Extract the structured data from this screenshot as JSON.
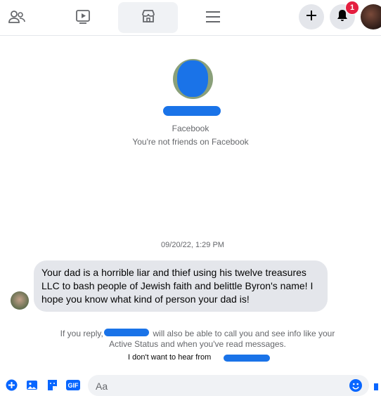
{
  "top_nav": {
    "friends": "friends-icon",
    "watch": "watch-icon",
    "marketplace": "marketplace-icon",
    "menu": "menu-icon",
    "create": "plus-icon",
    "notifications": "bell-icon",
    "notification_count": "1",
    "account": "avatar"
  },
  "profile": {
    "platform": "Facebook",
    "friend_status": "You're not friends on Facebook"
  },
  "conversation": {
    "timestamp": "09/20/22, 1:29 PM",
    "message": "Your dad is a horrible liar and thief using his twelve treasures LLC to bash people of Jewish faith and belittle Byron's name! I hope you know what kind of person your dad is!"
  },
  "notice": {
    "line1_prefix": "If you reply,",
    "line1_suffix": "will also be able to call you and see info like your",
    "line2": "Active Status and when you've read messages.",
    "dont_want": "I don't want to hear from"
  },
  "composer": {
    "placeholder": "Aa"
  },
  "colors": {
    "accent": "#0866ff",
    "badge": "#e41e3f",
    "bubble": "#e4e6eb",
    "secondary_text": "#65676b"
  }
}
